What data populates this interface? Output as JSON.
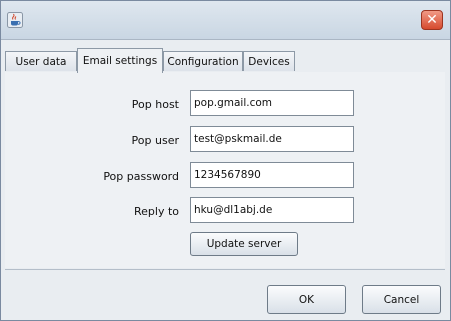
{
  "window": {
    "app_icon": "java-cup-icon",
    "close_icon": "close-icon",
    "close_glyph": "✕"
  },
  "tabs": [
    {
      "label": "User data",
      "active": false
    },
    {
      "label": "Email settings",
      "active": true
    },
    {
      "label": "Configuration",
      "active": false
    },
    {
      "label": "Devices",
      "active": false
    }
  ],
  "email_settings": {
    "pop_host": {
      "label": "Pop host",
      "value": "pop.gmail.com"
    },
    "pop_user": {
      "label": "Pop user",
      "value": "test@pskmail.de"
    },
    "pop_password": {
      "label": "Pop password",
      "value": "1234567890"
    },
    "reply_to": {
      "label": "Reply to",
      "value": "hku@dl1abj.de"
    },
    "update_button": "Update server"
  },
  "footer": {
    "ok_label": "OK",
    "cancel_label": "Cancel"
  }
}
